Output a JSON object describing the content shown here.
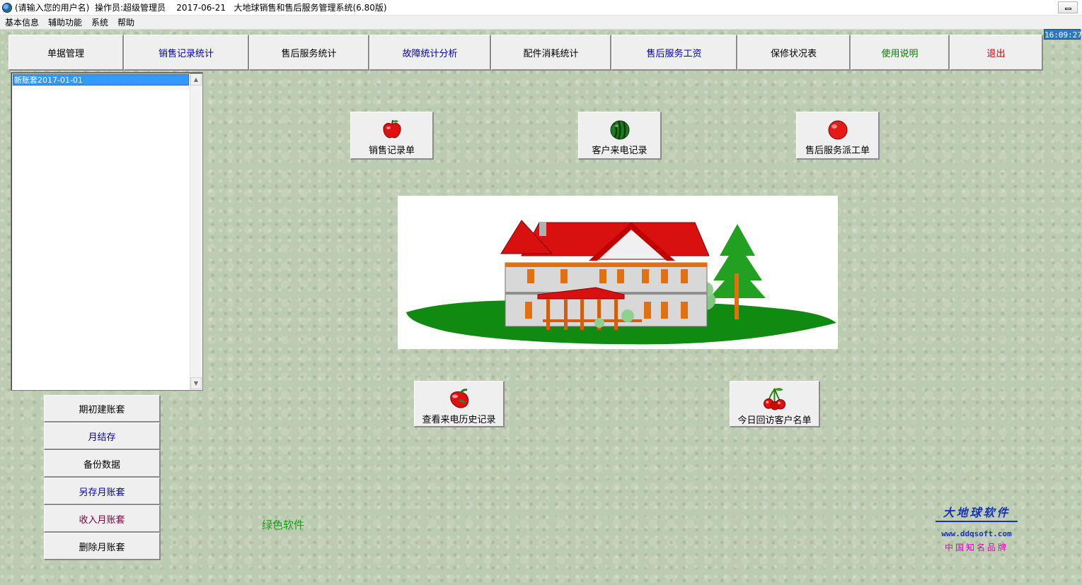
{
  "window": {
    "title": "(请输入您的用户名)  操作员:超级管理员    2017-06-21   大地球销售和售后服务管理系统(6.80版)",
    "clock": "16:09:27"
  },
  "menu": [
    "基本信息",
    "辅助功能",
    "系统",
    "帮助"
  ],
  "toolbar": [
    {
      "label": "单据管理",
      "color": "#000000"
    },
    {
      "label": "销售记录统计",
      "color": "#0000a8"
    },
    {
      "label": "售后服务统计",
      "color": "#000000"
    },
    {
      "label": "故障统计分析",
      "color": "#0000a8"
    },
    {
      "label": "配件消耗统计",
      "color": "#000000"
    },
    {
      "label": "售后服务工资",
      "color": "#0000a8"
    },
    {
      "label": "保修状况表",
      "color": "#000000"
    },
    {
      "label": "使用说明",
      "color": "#008000"
    },
    {
      "label": "退出",
      "color": "#d00000"
    }
  ],
  "account_list": {
    "items": [
      "新账套2017-01-01"
    ]
  },
  "side_buttons": [
    {
      "label": "期初建账套",
      "color": "#000000"
    },
    {
      "label": "月结存",
      "color": "#0000a8"
    },
    {
      "label": "备份数据",
      "color": "#000000"
    },
    {
      "label": "另存月账套",
      "color": "#0000a8"
    },
    {
      "label": "收入月账套",
      "color": "#800040"
    },
    {
      "label": "删除月账套",
      "color": "#000000"
    }
  ],
  "icon_buttons": {
    "sales_record": {
      "label": "销售记录单",
      "icon": "apple-icon"
    },
    "customer_call": {
      "label": "客户来电记录",
      "icon": "watermelon-icon"
    },
    "service_dispatch": {
      "label": "售后服务派工单",
      "icon": "tomato-icon"
    },
    "call_history": {
      "label": "查看来电历史记录",
      "icon": "pepper-icon"
    },
    "revisit_list": {
      "label": "今日回访客户名单",
      "icon": "cherry-icon"
    }
  },
  "green_label": "绿色软件",
  "logo": {
    "title": "大地球软件",
    "url": "www.ddqsoft.com",
    "slogan": "中国知名品牌"
  }
}
